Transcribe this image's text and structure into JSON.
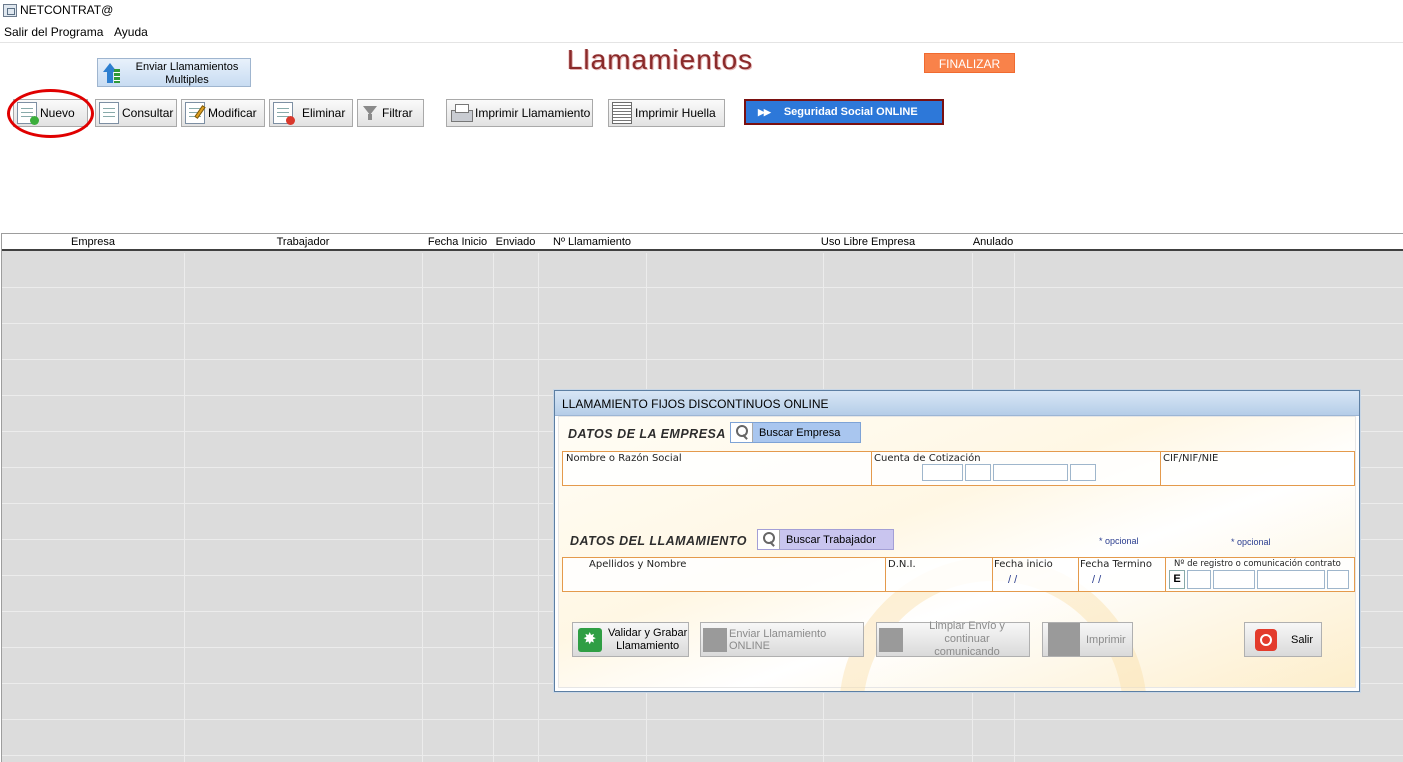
{
  "app": {
    "title": "NETCONTRAT@"
  },
  "menu": {
    "items": [
      "Salir del Programa",
      "Ayuda"
    ]
  },
  "page": {
    "title": "Llamamientos"
  },
  "toolbar": {
    "finalizar": "FINALIZAR",
    "multi_line1": "Enviar Llamamientos",
    "multi_line2": "Multiples",
    "nuevo": "Nuevo",
    "consultar": "Consultar",
    "modificar": "Modificar",
    "eliminar": "Eliminar",
    "filtrar": "Filtrar",
    "imprimir_llamamiento": "Imprimir Llamamiento",
    "imprimir_huella": "Imprimir Huella",
    "seguridad_social": "Seguridad Social ONLINE",
    "ss_arrows": "▶▶"
  },
  "grid": {
    "columns": [
      "Empresa",
      "Trabajador",
      "Fecha Inicio",
      "Enviado",
      "Nº Llamamiento",
      "Uso Libre Empresa",
      "Anulado"
    ]
  },
  "dialog": {
    "title": "LLAMAMIENTO FIJOS DISCONTINUOS ONLINE",
    "empresa_section": "DATOS DE LA EMPRESA",
    "buscar_empresa": "Buscar Empresa",
    "nombre_label": "Nombre o Razón Social",
    "cuenta_label": "Cuenta de Cotización",
    "cif_label": "CIF/NIF/NIE",
    "llamamiento_section": "DATOS DEL LLAMAMIENTO",
    "buscar_trabajador": "Buscar Trabajador",
    "opcional": "* opcional",
    "apellidos_label": "Apellidos y Nombre",
    "dni_label": "D.N.I.",
    "fecha_inicio_label": "Fecha inicio",
    "fecha_inicio_value": "/ /",
    "fecha_termino_label": "Fecha Termino",
    "fecha_termino_value": "/ /",
    "registro_label": "Nº de registro o comunicación contrato",
    "registro_prefix": "E",
    "btn_validar_1": "Validar y Grabar",
    "btn_validar_2": "Llamamiento",
    "btn_enviar": "Enviar Llamamiento ONLINE",
    "btn_limpiar_1": "Limpiar Envío y continuar",
    "btn_limpiar_2": "comunicando",
    "btn_imprimir": "Imprimir",
    "btn_salir": "Salir"
  },
  "colors": {
    "finalizar_bg": "#f9824a",
    "seguridad_social_bg": "#2d78d9",
    "title_color": "#8a2a2a",
    "highlight": "#e00000",
    "field_border": "#e49a4c"
  }
}
